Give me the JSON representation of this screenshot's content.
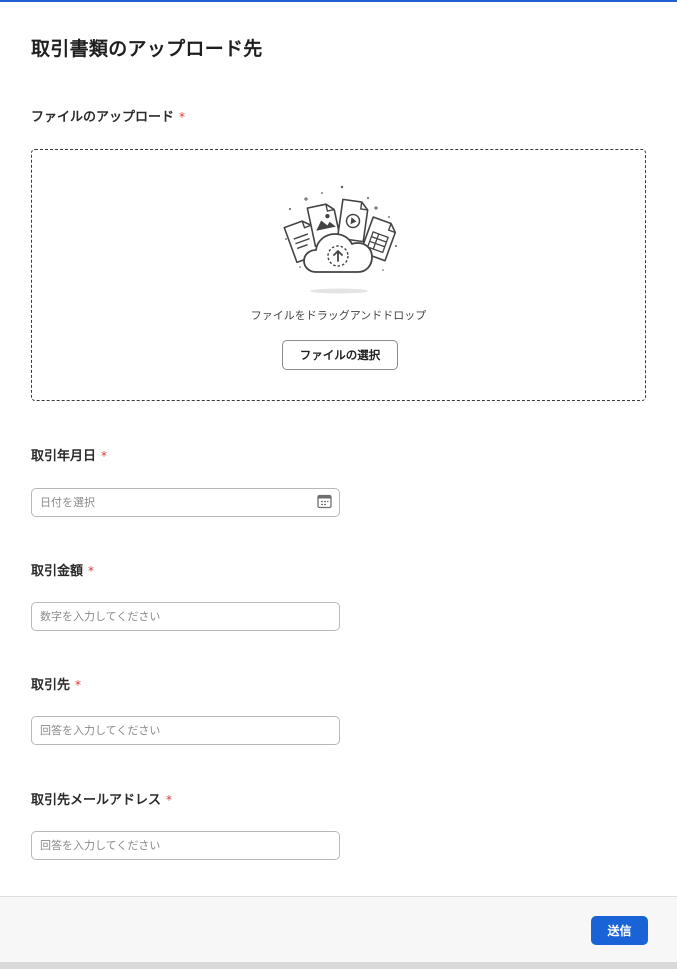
{
  "page": {
    "title": "取引書類のアップロード先",
    "required_mark": "*",
    "accent_color": "#1a63d6"
  },
  "upload": {
    "label": "ファイルのアップロード",
    "drop_text": "ファイルをドラッグアンドドロップ",
    "select_button_label": "ファイルの選択",
    "illustration_icon": "cloud-upload-files-icon"
  },
  "fields": {
    "date": {
      "label": "取引年月日",
      "placeholder": "日付を選択",
      "icon": "calendar-icon"
    },
    "amount": {
      "label": "取引金額",
      "placeholder": "数字を入力してください"
    },
    "partner": {
      "label": "取引先",
      "placeholder": "回答を入力してください"
    },
    "partner_email": {
      "label": "取引先メールアドレス",
      "placeholder": "回答を入力してください"
    }
  },
  "footer": {
    "submit_label": "送信"
  }
}
